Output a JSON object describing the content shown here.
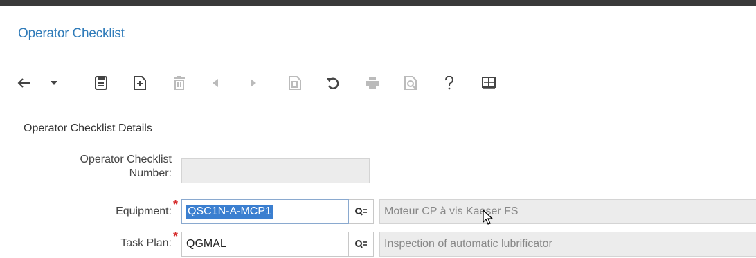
{
  "header": {
    "title": "Operator Checklist"
  },
  "toolbar": {
    "items": [
      {
        "icon": "back-arrow-icon",
        "enabled": true
      },
      {
        "icon": "chevron-down-icon",
        "enabled": true
      },
      {
        "icon": "save-icon",
        "enabled": true
      },
      {
        "icon": "new-record-icon",
        "enabled": true
      },
      {
        "icon": "delete-icon",
        "enabled": false
      },
      {
        "icon": "previous-icon",
        "enabled": false
      },
      {
        "icon": "next-icon",
        "enabled": false
      },
      {
        "icon": "copy-icon",
        "enabled": false
      },
      {
        "icon": "refresh-icon",
        "enabled": true
      },
      {
        "icon": "print-icon",
        "enabled": false
      },
      {
        "icon": "print-preview-icon",
        "enabled": false
      },
      {
        "icon": "help-icon",
        "enabled": true
      },
      {
        "icon": "book-icon",
        "enabled": true
      }
    ]
  },
  "details": {
    "section_title": "Operator Checklist Details",
    "fields": {
      "checklist_number": {
        "label_line1": "Operator Checklist",
        "label_line2": "Number:",
        "value": ""
      },
      "equipment": {
        "label": "Equipment:",
        "required": true,
        "value": "QSC1N-A-MCP1",
        "description": "Moteur CP à vis Kaeser FS"
      },
      "task_plan": {
        "label": "Task Plan:",
        "required": true,
        "value": "QGMAL",
        "description": "Inspection of automatic lubrificator"
      }
    }
  },
  "colors": {
    "accent": "#2f7bb9",
    "required": "#d62b2b",
    "selection": "#3b7fd0",
    "topbar": "#3a3a3a"
  }
}
